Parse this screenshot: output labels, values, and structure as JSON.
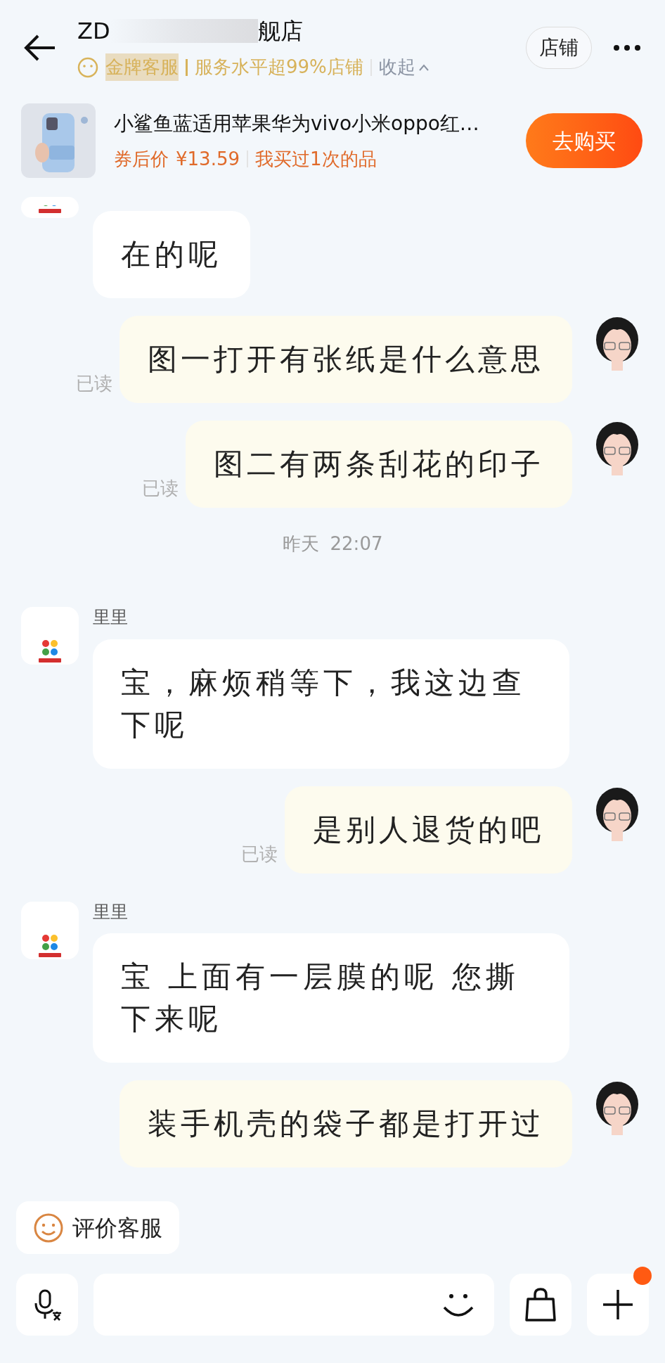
{
  "header": {
    "title_start": "ZD",
    "title_end": "舰店",
    "service_badge": "金牌客服",
    "service_level": "服务水平超99%店铺",
    "collapse": "收起",
    "store_button": "店铺"
  },
  "product": {
    "title": "小鲨鱼蓝适用苹果华为vivo小米oppo红…",
    "price_label": "券后价",
    "price": "¥13.59",
    "history": "我买过1次的品",
    "buy_button": "去购买"
  },
  "messages": [
    {
      "kind": "incoming",
      "text": "在的呢"
    },
    {
      "kind": "outgoing",
      "text": "图一打开有张纸是什么意思",
      "receipt": "已读"
    },
    {
      "kind": "outgoing",
      "text": "图二有两条刮花的印子",
      "receipt": "已读"
    },
    {
      "kind": "time",
      "day": "昨天",
      "time": "22:07"
    },
    {
      "kind": "incoming",
      "sender": "里里",
      "text": "宝，麻烦稍等下，我这边查下呢"
    },
    {
      "kind": "outgoing",
      "text": "是别人退货的吧",
      "receipt": "已读"
    },
    {
      "kind": "incoming",
      "sender": "里里",
      "text": "宝 上面有一层膜的呢 您撕下来呢"
    },
    {
      "kind": "outgoing",
      "text": "装手机壳的袋子都是打开过"
    }
  ],
  "rate_button": "评价客服",
  "plus_badge": true
}
